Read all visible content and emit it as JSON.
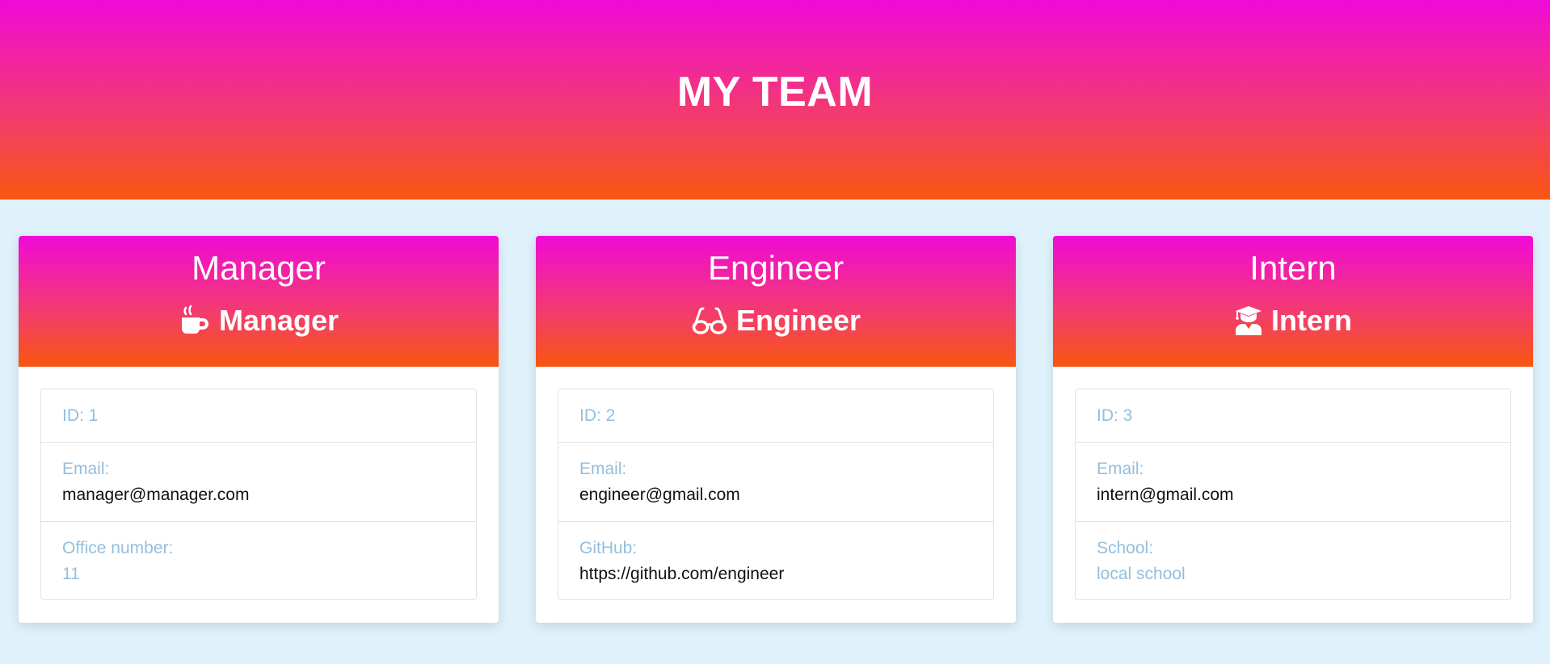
{
  "header": {
    "title": "MY TEAM"
  },
  "colors": {
    "gradient_top": "#f00ad8",
    "gradient_bottom": "#f8560f",
    "page_bg": "#dff2fb",
    "label_color": "#93bfdc"
  },
  "cards": [
    {
      "name": "Manager",
      "role": "Manager",
      "role_icon": "coffee-cup-icon",
      "id_text": "ID: 1",
      "email_label": "Email:",
      "email": "manager@manager.com",
      "extra_label": "Office number:",
      "extra_value": "11"
    },
    {
      "name": "Engineer",
      "role": "Engineer",
      "role_icon": "glasses-icon",
      "id_text": "ID: 2",
      "email_label": "Email:",
      "email": "engineer@gmail.com",
      "extra_label": "GitHub:",
      "extra_value": "https://github.com/engineer"
    },
    {
      "name": "Intern",
      "role": "Intern",
      "role_icon": "graduate-icon",
      "id_text": "ID: 3",
      "email_label": "Email:",
      "email": "intern@gmail.com",
      "extra_label": "School:",
      "extra_value": "local school"
    }
  ]
}
